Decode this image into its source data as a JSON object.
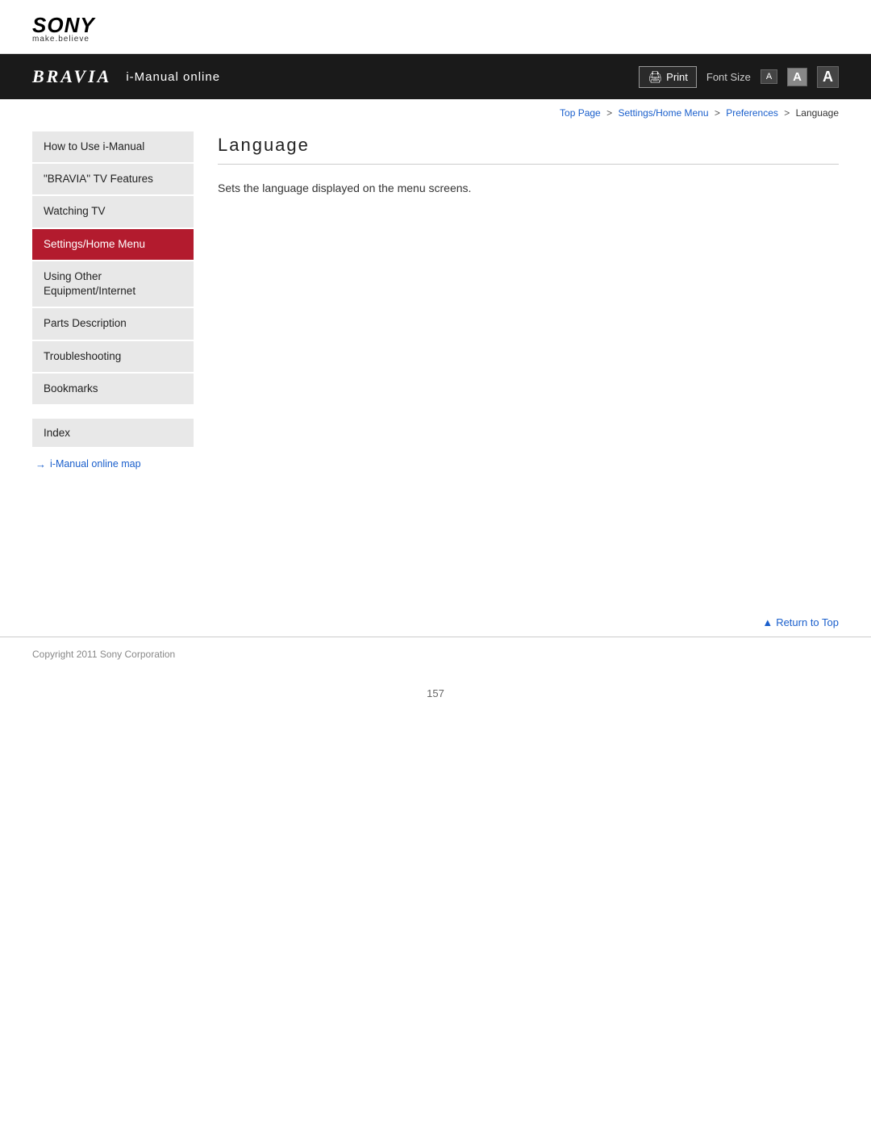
{
  "logo": {
    "sony": "SONY",
    "tagline": "make.believe"
  },
  "banner": {
    "bravia": "BRAVIA",
    "imanual": "i-Manual online",
    "print_label": "Print",
    "font_size_label": "Font Size",
    "font_small": "A",
    "font_medium": "A",
    "font_large": "A"
  },
  "breadcrumb": {
    "top_page": "Top Page",
    "sep1": ">",
    "settings": "Settings/Home Menu",
    "sep2": ">",
    "preferences": "Preferences",
    "sep3": ">",
    "current": "Language"
  },
  "sidebar": {
    "items": [
      {
        "label": "How to Use i-Manual",
        "active": false
      },
      {
        "label": "\"BRAVIA\" TV Features",
        "active": false
      },
      {
        "label": "Watching TV",
        "active": false
      },
      {
        "label": "Settings/Home Menu",
        "active": true
      },
      {
        "label": "Using Other Equipment/Internet",
        "active": false
      },
      {
        "label": "Parts Description",
        "active": false
      },
      {
        "label": "Troubleshooting",
        "active": false
      },
      {
        "label": "Bookmarks",
        "active": false
      }
    ],
    "index_label": "Index",
    "map_link": "i-Manual online map"
  },
  "content": {
    "page_title": "Language",
    "description": "Sets the language displayed on the menu screens."
  },
  "footer": {
    "return_to_top": "Return to Top",
    "copyright": "Copyright 2011 Sony Corporation",
    "page_number": "157"
  }
}
